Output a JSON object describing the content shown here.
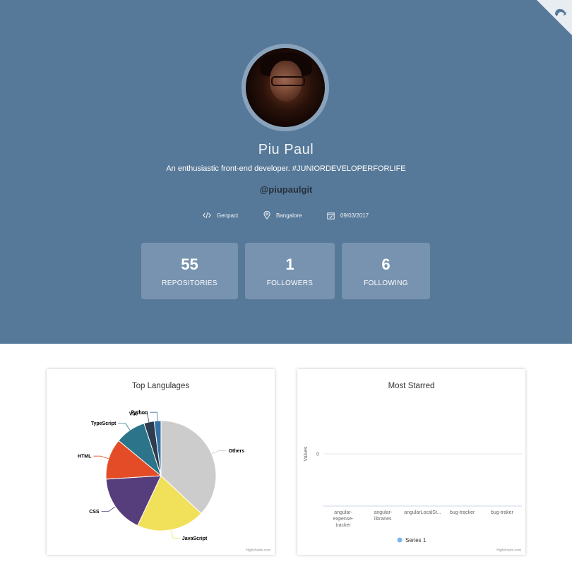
{
  "header": {
    "name": "Piu Paul",
    "bio": "An enthusiastic front-end developer. #JUNIORDEVELOPERFORLIFE",
    "login": "@piupaulgit",
    "meta": {
      "company": "Genpact",
      "location": "Bangalore",
      "joined": "09/03/2017"
    },
    "stats": [
      {
        "value": "55",
        "label": "REPOSITORIES"
      },
      {
        "value": "1",
        "label": "FOLLOWERS"
      },
      {
        "value": "6",
        "label": "FOLLOWING"
      }
    ],
    "colors": {
      "header_bg": "#577999",
      "stat_bg": "#7893b0"
    }
  },
  "languages_chart": {
    "title": "Top Langulages",
    "credits": "Highcharts.com",
    "chart_data": {
      "type": "pie",
      "title": "Top Langulages",
      "labels": [
        "Others",
        "JavaScript",
        "CSS",
        "HTML",
        "TypeScript",
        "Vue",
        "Python"
      ],
      "values": [
        37,
        20,
        17,
        12,
        9,
        3,
        2
      ],
      "colors": [
        "#cccccc",
        "#f1e05a",
        "#563d7c",
        "#e34c26",
        "#2b7489",
        "#2c3e50",
        "#3572a5"
      ]
    }
  },
  "starred_chart": {
    "title": "Most Starred",
    "credits": "Highcharts.com",
    "chart_data": {
      "type": "bar",
      "title": "Most Starred",
      "ylabel": "Values",
      "categories": [
        "angular-expense-tracker",
        "angular-libraries",
        "angularLocalSt...",
        "bug-tracker",
        "bug-traker"
      ],
      "category_lines": [
        [
          "angular-",
          "expense-",
          "tracker"
        ],
        [
          "angular-",
          "libraries"
        ],
        [
          "angularLocalSt..."
        ],
        [
          "bug-tracker"
        ],
        [
          "bug-traker"
        ]
      ],
      "series": [
        {
          "name": "Series 1",
          "values": [
            0,
            0,
            0,
            0,
            0
          ]
        }
      ],
      "yticks": [
        "0"
      ],
      "legend": "bottom-center"
    }
  }
}
